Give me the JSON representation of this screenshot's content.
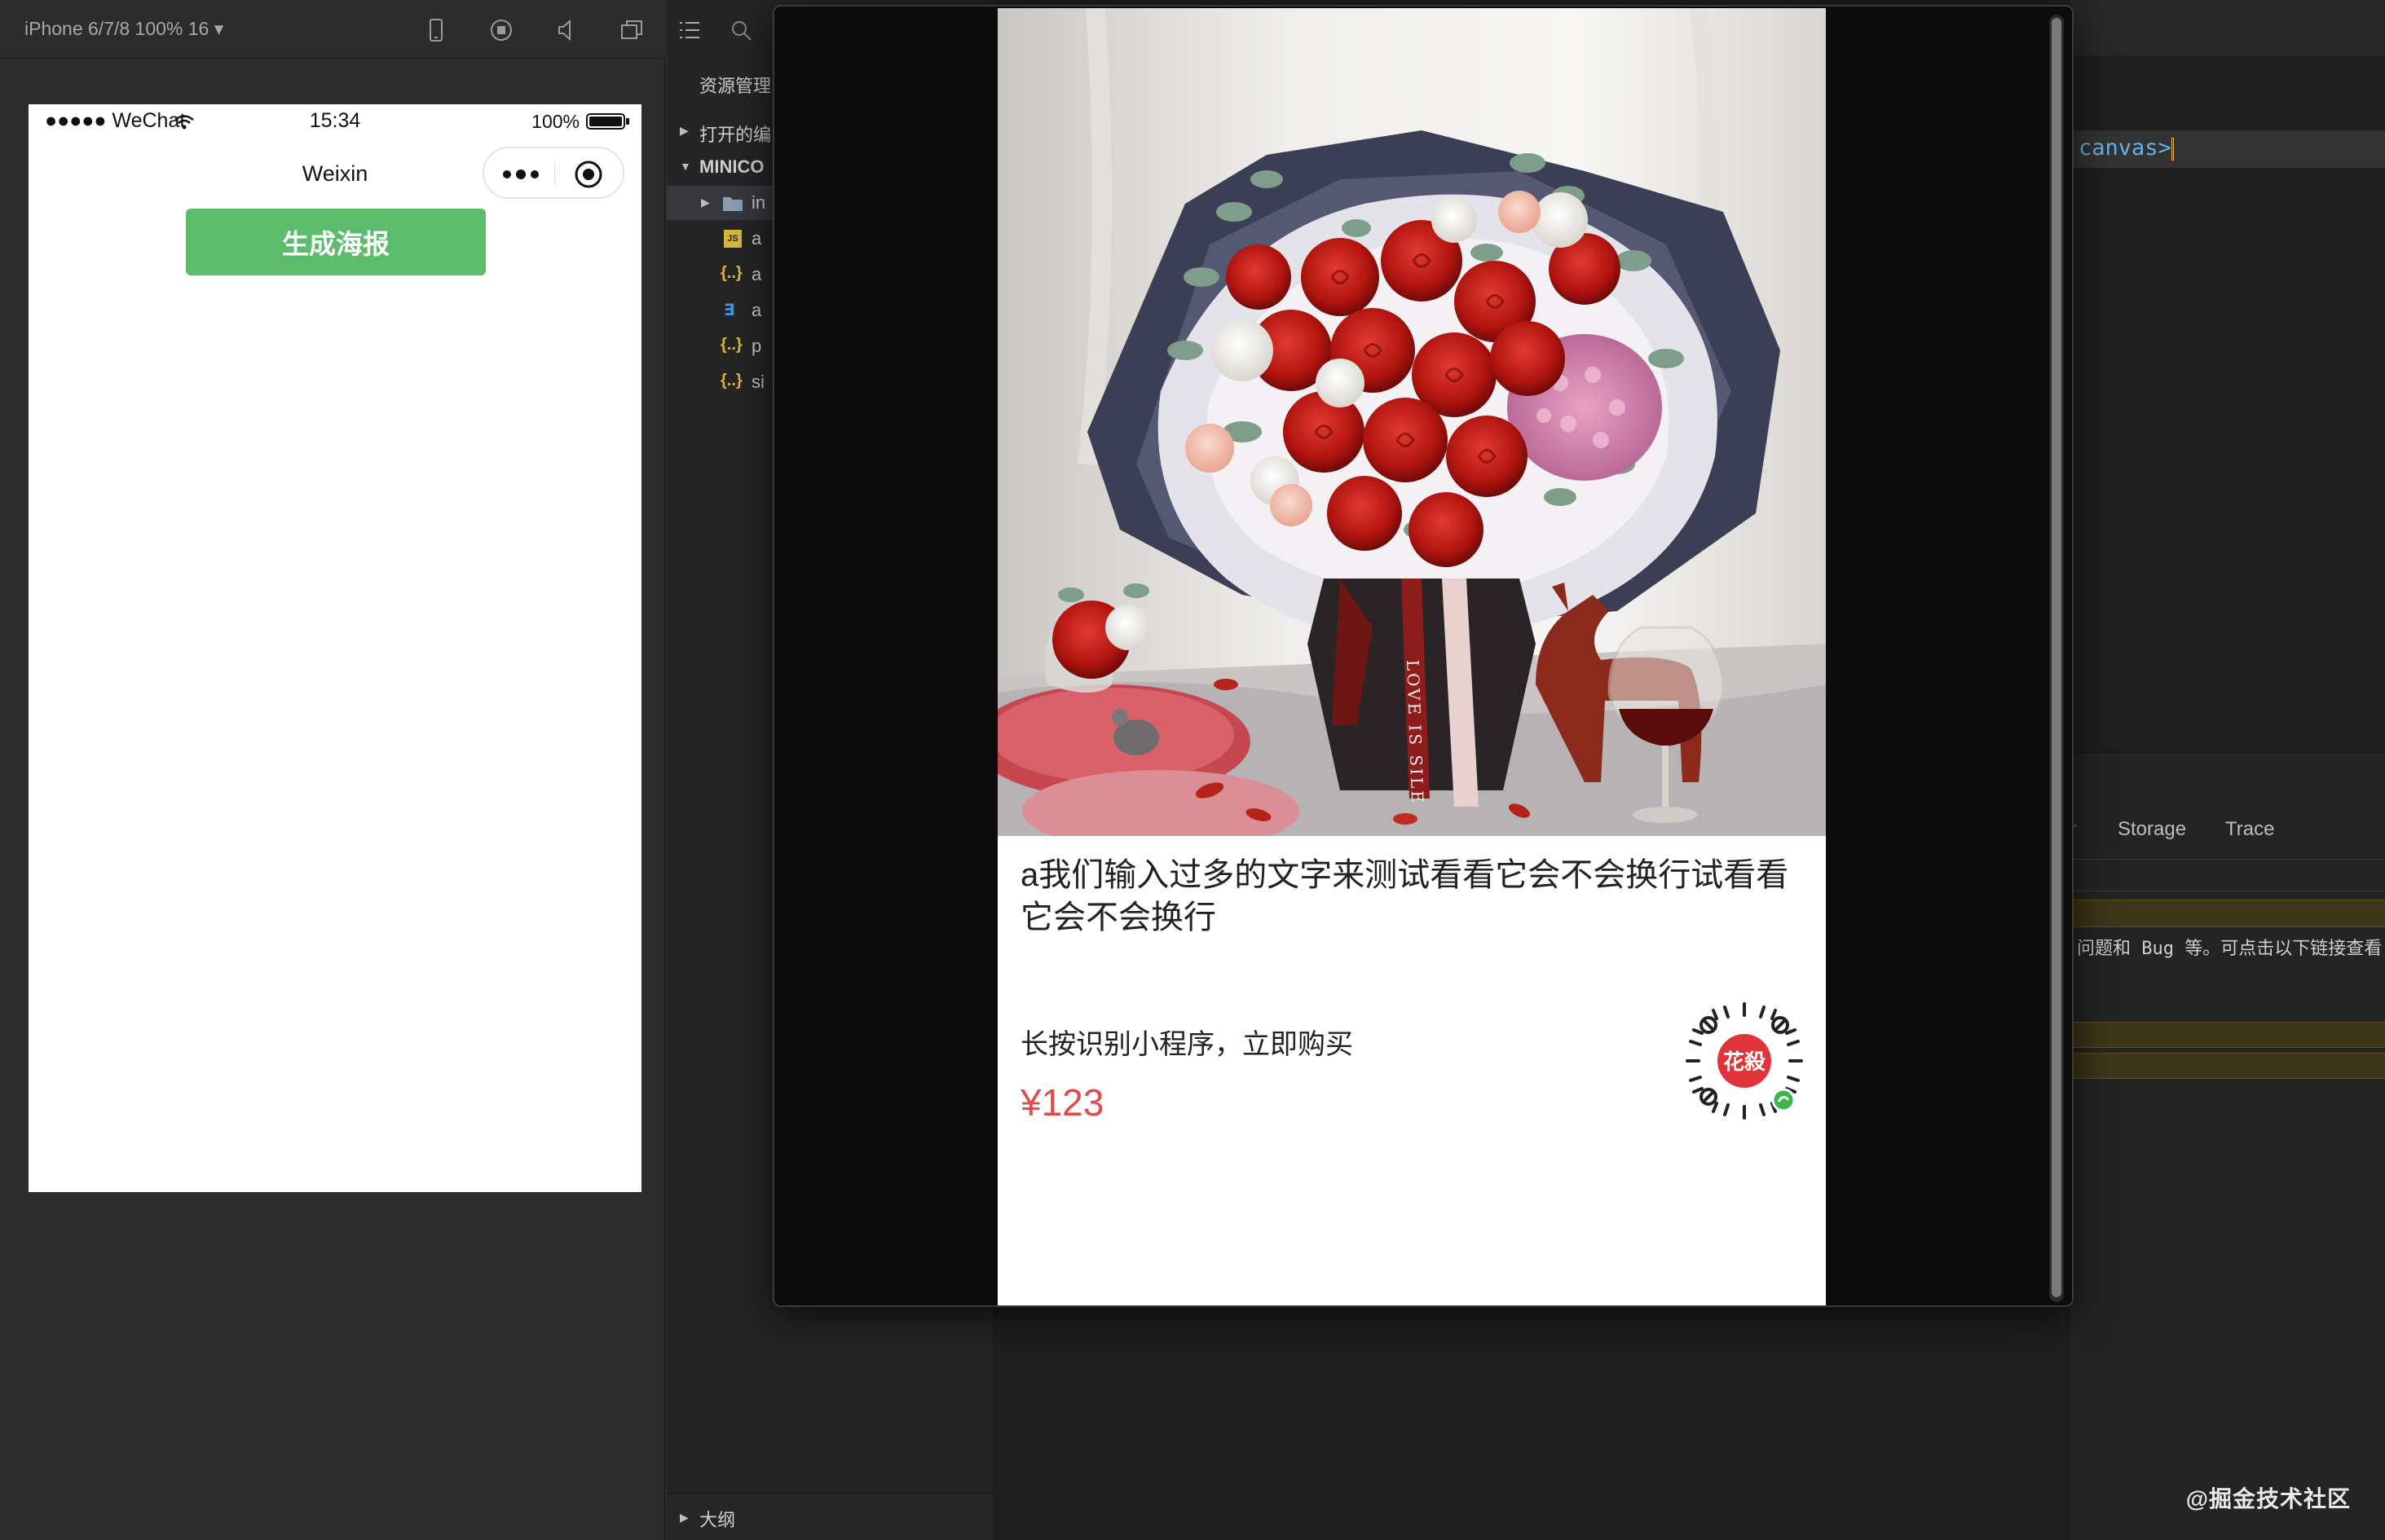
{
  "simulator": {
    "device_label": "iPhone 6/7/8 100% 16 ▾",
    "status": {
      "carrier": "●●●●● WeChat",
      "time": "15:34",
      "battery": "100%"
    },
    "nav_title": "Weixin",
    "action_button": "生成海报"
  },
  "explorer": {
    "title": "资源管理",
    "items": [
      {
        "label": "打开的编",
        "arrow": "▶"
      },
      {
        "label": "MINICO",
        "arrow": "▼"
      },
      {
        "label": "in",
        "arrow": "▶"
      },
      {
        "label": "a",
        "icon": "JS"
      },
      {
        "label": "a",
        "icon": "{..}"
      },
      {
        "label": "a",
        "icon": "∃"
      },
      {
        "label": "p",
        "icon": "{..}"
      },
      {
        "label": "si",
        "icon": "{..}"
      }
    ],
    "outline": "大纲",
    "outline_arrow": "▶"
  },
  "editor": {
    "code_line": "canvas>"
  },
  "devtools": {
    "tabs": [
      "r",
      "Storage",
      "Trace"
    ],
    "console_message": "问题和 Bug 等。可点击以下链接查看("
  },
  "poster": {
    "description": "a我们输入过多的文字来测试看看它会不会换行试看看它会不会换行",
    "tip": "长按识别小程序，立即购买",
    "price": "¥123",
    "qr_badge": "花殺",
    "ribbon_text": "LOVE IS SILE"
  },
  "watermark": "@掘金技术社区",
  "colors": {
    "primary_button": "#5cbc6b",
    "price": "#e24a4a",
    "ide_bg": "#2c2c2c",
    "modal_bg": "#0b0b0b"
  }
}
